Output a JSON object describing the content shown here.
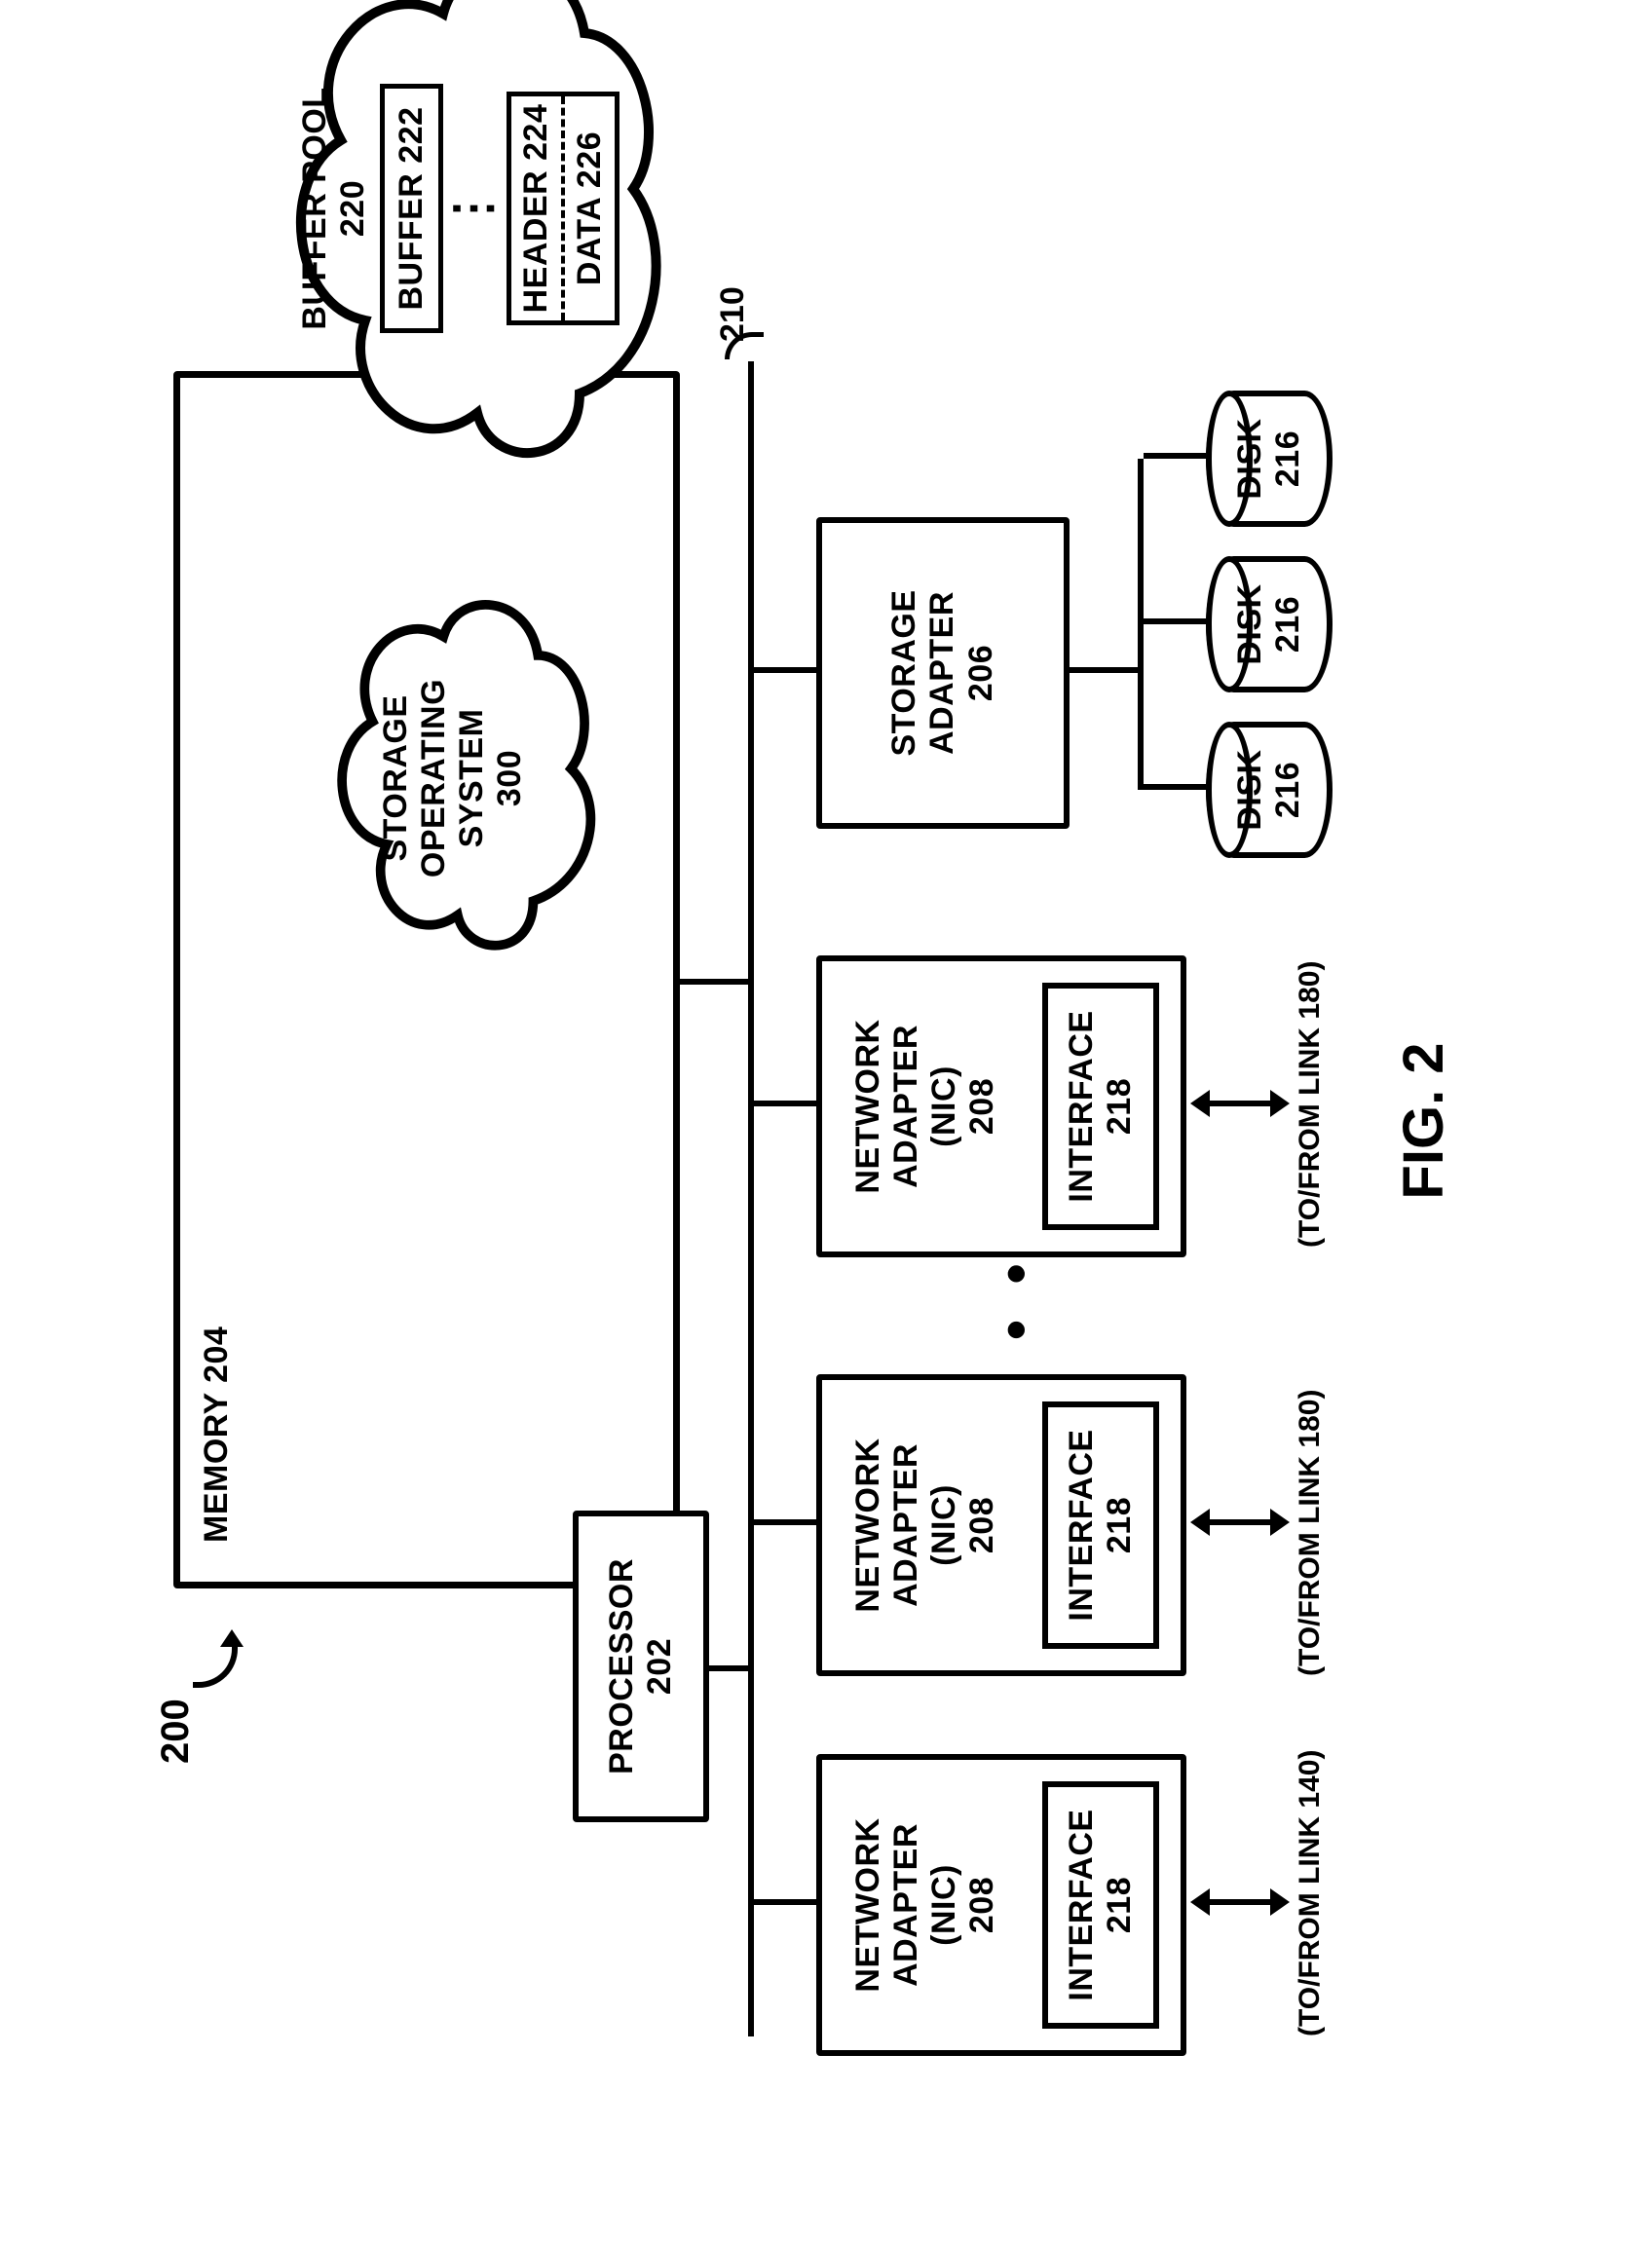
{
  "figure_ref": "200",
  "figure_caption": "FIG. 2",
  "bus_ref": "210",
  "memory": {
    "title": "MEMORY  204"
  },
  "processor": {
    "line1": "PROCESSOR",
    "line2": "202"
  },
  "sos": {
    "line1": "STORAGE",
    "line2": "OPERATING",
    "line3": "SYSTEM",
    "line4": "300"
  },
  "buffer_pool": {
    "title1": "BUFFER POOL",
    "title2": "220",
    "buf1": "BUFFER 222",
    "hdr": "HEADER 224",
    "dat": "DATA 226",
    "callout": "222"
  },
  "nic": {
    "l1": "NETWORK",
    "l2": "ADAPTER",
    "l3": "(NIC)",
    "l4": "208",
    "iface1": "INTERFACE",
    "iface2": "218"
  },
  "storage_adapter": {
    "l1": "STORAGE",
    "l2": "ADAPTER",
    "l3": "206"
  },
  "disk": {
    "l1": "DISK",
    "l2": "216"
  },
  "tofrom": {
    "t1": "(TO/FROM LINK 140)",
    "t2": "(TO/FROM LINK 180)",
    "t3": "(TO/FROM LINK 180)"
  },
  "ellipsis": "• • •"
}
